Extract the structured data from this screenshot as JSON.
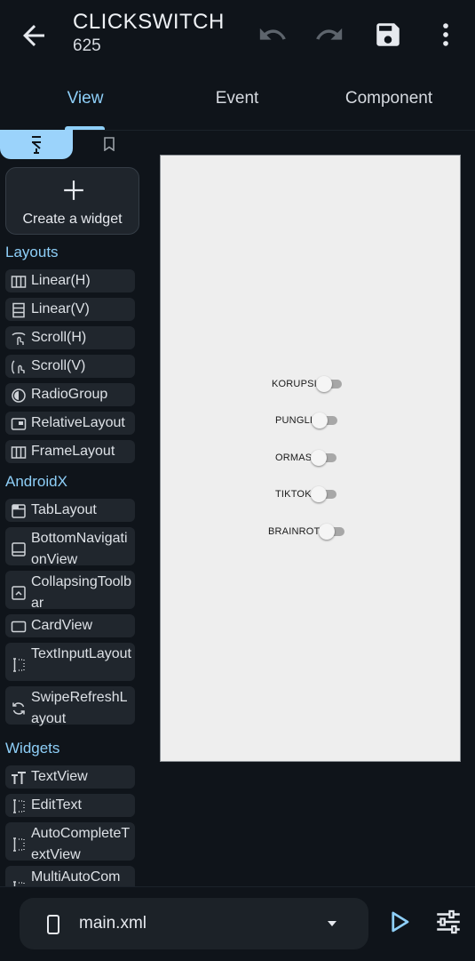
{
  "header": {
    "title": "CLICKSWITCH",
    "subtitle": "625"
  },
  "tabs": [
    "View",
    "Event",
    "Component"
  ],
  "palette": {
    "create_label": "Create a widget",
    "sections": {
      "layouts": "Layouts",
      "androidx": "AndroidX",
      "widgets": "Widgets"
    },
    "layouts": [
      "Linear(H)",
      "Linear(V)",
      "Scroll(H)",
      "Scroll(V)",
      "RadioGroup",
      "RelativeLayout",
      "FrameLayout"
    ],
    "androidx": [
      "TabLayout",
      "BottomNavigationView",
      "CollapsingToolbar",
      "CardView",
      "TextInputLayout",
      "SwipeRefreshLayout"
    ],
    "widgets": [
      "TextView",
      "EditText",
      "AutoCompleteTextView",
      "MultiAutoCom"
    ]
  },
  "canvas": {
    "switches": [
      "KORUPSI",
      "PUNGLI",
      "ORMAS",
      "TIKTOK",
      "BRAINROT"
    ]
  },
  "footer": {
    "file_name": "main.xml"
  },
  "colors": {
    "accent": "#8ecff8",
    "background": "#0f141a",
    "item_bg": "#20262d"
  }
}
